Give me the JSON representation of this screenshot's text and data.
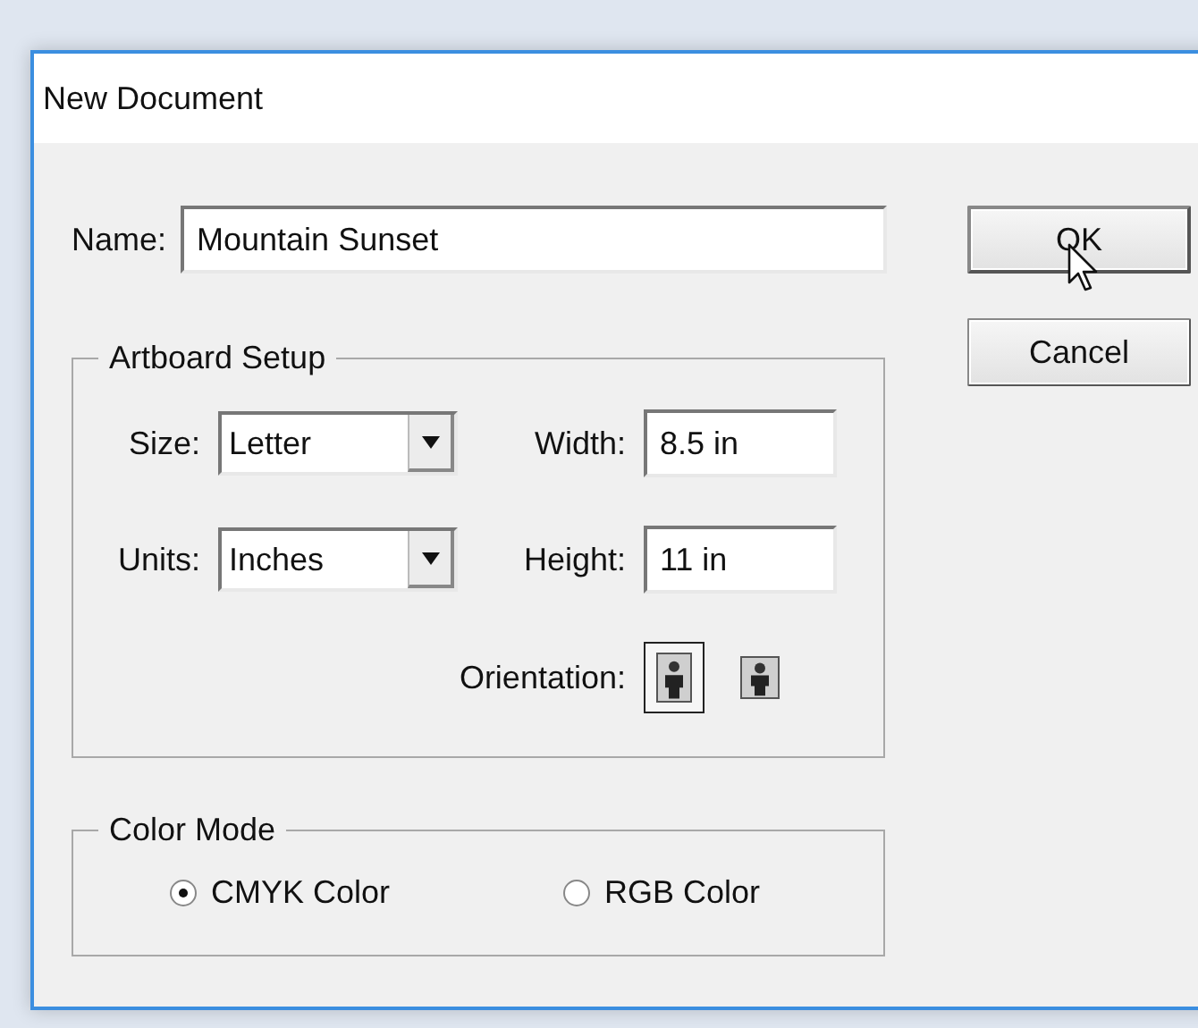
{
  "window": {
    "title": "New Document"
  },
  "name": {
    "label": "Name:",
    "value": "Mountain Sunset"
  },
  "buttons": [
    {
      "label": "OK",
      "default": true
    },
    {
      "label": "Cancel",
      "default": false
    }
  ],
  "artboard": {
    "title": "Artboard Setup",
    "size": {
      "label": "Size:",
      "value": "Letter"
    },
    "width": {
      "label": "Width:",
      "value": "8.5 in"
    },
    "units": {
      "label": "Units:",
      "value": "Inches"
    },
    "height": {
      "label": "Height:",
      "value": "11 in"
    },
    "orientation": {
      "label": "Orientation:",
      "options": [
        {
          "kind": "portrait",
          "selected": true
        },
        {
          "kind": "landscape",
          "selected": false
        }
      ]
    }
  },
  "color_mode": {
    "title": "Color Mode",
    "options": [
      {
        "label": "CMYK Color",
        "selected": true
      },
      {
        "label": "RGB Color",
        "selected": false
      }
    ]
  }
}
